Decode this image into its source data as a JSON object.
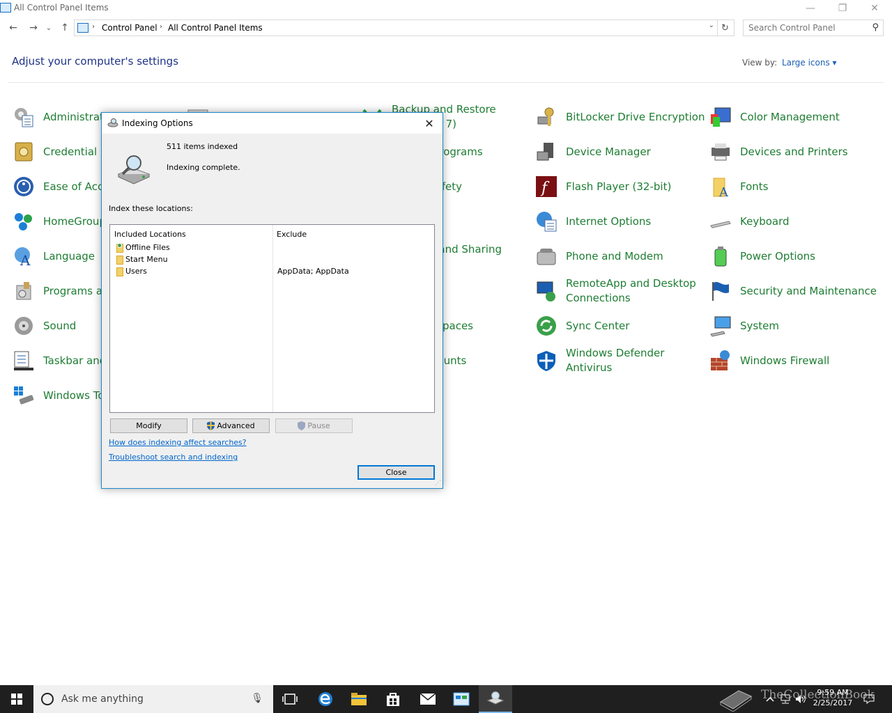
{
  "window": {
    "title": "All Control Panel Items",
    "minimize_glyph": "—",
    "restore_glyph": "❐",
    "close_glyph": "✕"
  },
  "nav": {
    "back_glyph": "←",
    "forward_glyph": "→",
    "recent_glyph": "⌄",
    "up_glyph": "↑",
    "breadcrumb": [
      "Control Panel",
      "All Control Panel Items"
    ],
    "sep_glyph": "›",
    "dropdown_glyph": "⌄",
    "refresh_glyph": "↻",
    "search_placeholder": "Search Control Panel",
    "search_glyph": "⚲"
  },
  "header": {
    "title": "Adjust your computer's settings",
    "viewby_label": "View by:",
    "viewby_value": "Large icons ▾"
  },
  "items": {
    "administrative_tools": "Administrative Tools",
    "credential_manager": "Credential Manager",
    "ease_of_access": "Ease of Access Center",
    "homegroup": "HomeGroup",
    "language": "Language",
    "programs_and_features": "Programs and Features",
    "sound": "Sound",
    "taskbar_and_navigation": "Taskbar and Navigation",
    "windows_to_go": "Windows To Go",
    "backup_and_restore_1": "Backup and Restore",
    "backup_and_restore_2": "(Windows 7)",
    "default_programs": "Default Programs",
    "family_safety": "Family Safety",
    "network_and_sharing": "Network and Sharing",
    "storage_spaces": "Storage Spaces",
    "user_accounts": "User Accounts",
    "bitlocker": "BitLocker Drive Encryption",
    "device_manager": "Device Manager",
    "flash_player": "Flash Player (32-bit)",
    "internet_options": "Internet Options",
    "phone_and_modem": "Phone and Modem",
    "remoteapp_1": "RemoteApp and Desktop",
    "remoteapp_2": "Connections",
    "sync_center": "Sync Center",
    "windows_defender_1": "Windows Defender",
    "windows_defender_2": "Antivirus",
    "color_management": "Color Management",
    "devices_and_printers": "Devices and Printers",
    "fonts": "Fonts",
    "keyboard": "Keyboard",
    "power_options": "Power Options",
    "security_and_maintenance": "Security and Maintenance",
    "system": "System",
    "windows_firewall": "Windows Firewall"
  },
  "dialog": {
    "title": "Indexing Options",
    "close_glyph": "✕",
    "items_indexed": "511 items indexed",
    "status": "Indexing complete.",
    "index_label": "Index these locations:",
    "col_included": "Included Locations",
    "col_exclude": "Exclude",
    "locations": [
      {
        "name": "Offline Files",
        "exclude": ""
      },
      {
        "name": "Start Menu",
        "exclude": ""
      },
      {
        "name": "Users",
        "exclude": "AppData; AppData"
      }
    ],
    "modify": "Modify",
    "advanced": "Advanced",
    "pause": "Pause",
    "link_how": "How does indexing affect searches?",
    "link_troubleshoot": "Troubleshoot search and indexing",
    "close_button": "Close",
    "grip_glyph": "⋰"
  },
  "taskbar": {
    "search_text": "Ask me anything",
    "mic_glyph": "🎙",
    "time": "9:59 AM",
    "date": "2/25/2017",
    "watermark": "TheCollectionBook"
  },
  "colors": {
    "accent": "#0078d7",
    "link_green": "#1e7d33",
    "heading_blue": "#1e3287"
  }
}
